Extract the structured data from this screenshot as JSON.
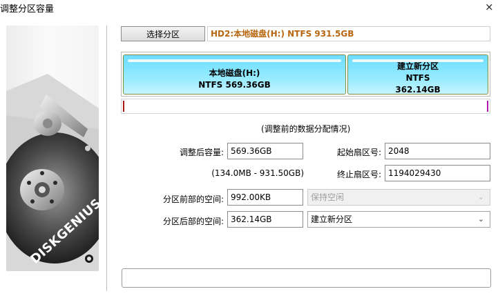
{
  "window": {
    "title": "调整分区容量",
    "close_glyph": "×"
  },
  "branding": {
    "logo_text": "DISKGENIUS"
  },
  "toolbar": {
    "select_partition_label": "选择分区",
    "disk_info": "HD2:本地磁盘(H:) NTFS 931.5GB"
  },
  "partition_map": {
    "segments": [
      {
        "name_label": "本地磁盘(H:)",
        "detail_label": "NTFS 569.36GB"
      },
      {
        "name_label": "建立新分区",
        "fs_label": "NTFS",
        "size_label": "362.14GB"
      }
    ],
    "color": "#7fe4ff"
  },
  "caption": "(调整前的数据分配情况)",
  "form": {
    "new_size_label": "调整后容量:",
    "new_size_value": "569.36GB",
    "range_hint": "(134.0MB - 931.50GB)",
    "start_sector_label": "起始扇区号:",
    "start_sector_value": "2048",
    "end_sector_label": "终止扇区号:",
    "end_sector_value": "1194029430",
    "space_before_label": "分区前部的空间:",
    "space_before_value": "992.00KB",
    "space_before_option": "保持空闲",
    "space_after_label": "分区后部的空间:",
    "space_after_value": "362.14GB",
    "space_after_option": "建立新分区"
  },
  "icons": {
    "close": "close-icon",
    "dropdown": "chevron-down-icon",
    "logo": "disk-image"
  },
  "colors": {
    "disk_info_text": "#b8660f",
    "partition_fill": "#7fe4ff"
  }
}
